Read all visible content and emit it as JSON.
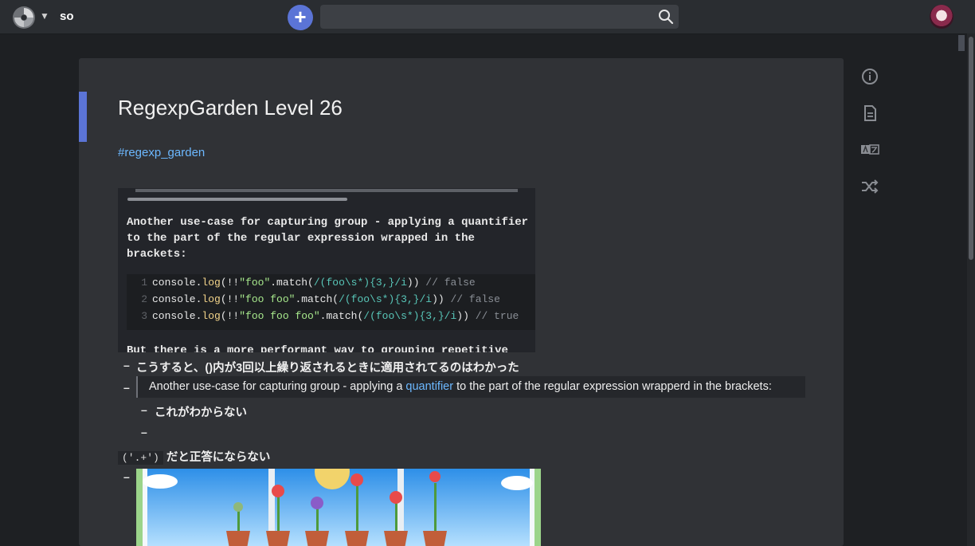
{
  "header": {
    "project_name": "so",
    "search": {
      "value": "",
      "placeholder": ""
    }
  },
  "page": {
    "title": "RegexpGarden Level 26",
    "tag": "#regexp_garden",
    "embed": {
      "paragraph": "Another use-case for capturing group - applying a quantifier to the part of the regular expression wrapped in the brackets:",
      "code_lines": [
        {
          "num": "1",
          "pre": "console.",
          "fn": "log",
          "mid": "(!!",
          "str": "\"foo\"",
          "mid2": ".match(",
          "re": "/(foo\\s*){3,}/i",
          "end": ")) ",
          "comment": "// false"
        },
        {
          "num": "2",
          "pre": "console.",
          "fn": "log",
          "mid": "(!!",
          "str": "\"foo foo\"",
          "mid2": ".match(",
          "re": "/(foo\\s*){3,}/i",
          "end": ")) ",
          "comment": "// false"
        },
        {
          "num": "3",
          "pre": "console.",
          "fn": "log",
          "mid": "(!!",
          "str": "\"foo foo foo\"",
          "mid2": ".match(",
          "re": "/(foo\\s*){3,}/i",
          "end": ")) ",
          "comment": "// true"
        }
      ],
      "more_text": "But there is a more performant way to grouping repetitive"
    },
    "lines": {
      "line1": "こうすると、()内が3回以上繰り返されるときに適用されてるのはわかった",
      "quote_before": "Another use-case for capturing group - applying a ",
      "quote_link": "quantifier",
      "quote_after": " to the part of the regular expression wrapperd in the brackets:",
      "line3": "これがわからない",
      "code_inline": "('.+')",
      "line5": "だと正答にならない"
    }
  },
  "icons": [
    "logo-icon",
    "chevron-down-icon",
    "plus-icon",
    "search-icon",
    "info-icon",
    "document-icon",
    "translate-icon",
    "shuffle-icon"
  ],
  "colors": {
    "accent": "#5b74d6",
    "link": "#6cb8ff",
    "page_bg": "#303236",
    "app_bg": "#1e2023"
  }
}
